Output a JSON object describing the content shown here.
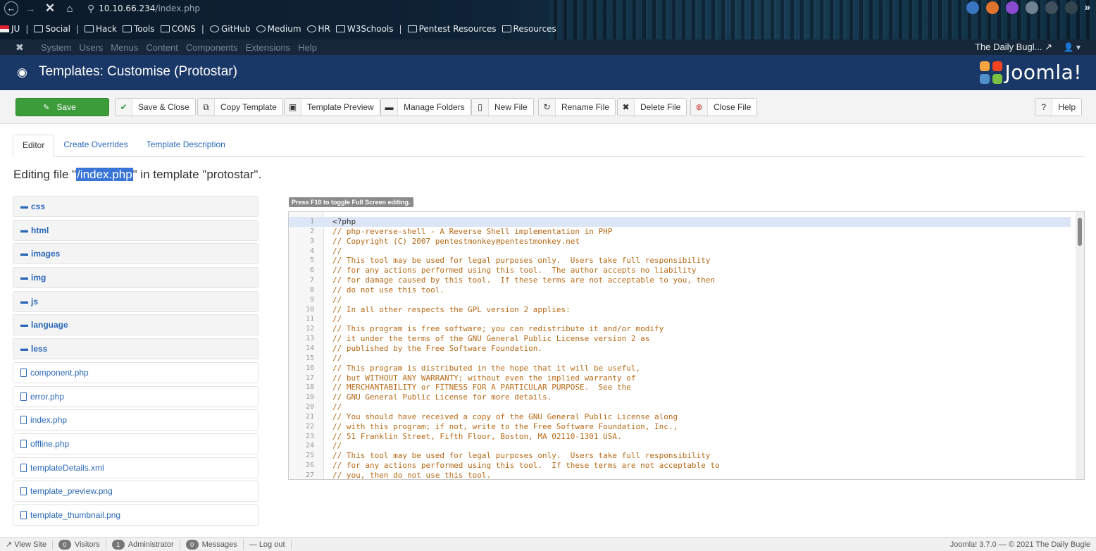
{
  "browser": {
    "url_host": "10.10.66.234",
    "url_path": "/index.php",
    "bookmarks": [
      {
        "label": "JU",
        "icon": "flag-icon"
      },
      {
        "label": "Social",
        "icon": "folder-icon"
      },
      {
        "label": "Hack",
        "icon": "folder-icon"
      },
      {
        "label": "Tools",
        "icon": "folder-icon"
      },
      {
        "label": "CONS",
        "icon": "folder-icon"
      },
      {
        "label": "GitHub",
        "icon": "github-icon"
      },
      {
        "label": "Medium",
        "icon": "medium-icon"
      },
      {
        "label": "HR",
        "icon": "globe-icon"
      },
      {
        "label": "W3Schools",
        "icon": "w3-icon"
      },
      {
        "label": "Pentest Resources",
        "icon": "folder-icon"
      },
      {
        "label": "Resources",
        "icon": "folder-icon"
      }
    ],
    "more_glyph": "»"
  },
  "admin_nav": {
    "menu": [
      "System",
      "Users",
      "Menus",
      "Content",
      "Components",
      "Extensions",
      "Help"
    ],
    "site_name": "The Daily Bugl..."
  },
  "page": {
    "title": "Templates: Customise (Protostar)",
    "brand": "Joomla!"
  },
  "toolbar": {
    "save": "Save",
    "save_close": "Save & Close",
    "copy_template": "Copy Template",
    "template_preview": "Template Preview",
    "manage_folders": "Manage Folders",
    "new_file": "New File",
    "rename_file": "Rename File",
    "delete_file": "Delete File",
    "close_file": "Close File",
    "help": "Help"
  },
  "tabs": [
    "Editor",
    "Create Overrides",
    "Template Description"
  ],
  "heading": {
    "prefix": "Editing file \"",
    "file": "/index.php",
    "suffix": "\" in template \"protostar\"."
  },
  "tree": {
    "folders": [
      "css",
      "html",
      "images",
      "img",
      "js",
      "language",
      "less"
    ],
    "files": [
      "component.php",
      "error.php",
      "index.php",
      "offline.php",
      "templateDetails.xml",
      "template_preview.png",
      "template_thumbnail.png"
    ]
  },
  "editor": {
    "hint": "Press F10 to toggle Full Screen editing.",
    "lines": [
      "<?php",
      "// php-reverse-shell - A Reverse Shell implementation in PHP",
      "// Copyright (C) 2007 pentestmonkey@pentestmonkey.net",
      "//",
      "// This tool may be used for legal purposes only.  Users take full responsibility",
      "// for any actions performed using this tool.  The author accepts no liability",
      "// for damage caused by this tool.  If these terms are not acceptable to you, then",
      "// do not use this tool.",
      "//",
      "// In all other respects the GPL version 2 applies:",
      "//",
      "// This program is free software; you can redistribute it and/or modify",
      "// it under the terms of the GNU General Public License version 2 as",
      "// published by the Free Software Foundation.",
      "//",
      "// This program is distributed in the hope that it will be useful,",
      "// but WITHOUT ANY WARRANTY; without even the implied warranty of",
      "// MERCHANTABILITY or FITNESS FOR A PARTICULAR PURPOSE.  See the",
      "// GNU General Public License for more details.",
      "//",
      "// You should have received a copy of the GNU General Public License along",
      "// with this program; if not, write to the Free Software Foundation, Inc.,",
      "// 51 Franklin Street, Fifth Floor, Boston, MA 02110-1301 USA.",
      "//",
      "// This tool may be used for legal purposes only.  Users take full responsibility",
      "// for any actions performed using this tool.  If these terms are not acceptable to",
      "// you, then do not use this tool."
    ]
  },
  "statusbar": {
    "view_site": "View Site",
    "visitors_count": "0",
    "visitors": "Visitors",
    "admin_count": "1",
    "admin": "Administrator",
    "messages_count": "0",
    "messages": "Messages",
    "logout": "Log out",
    "copyright": "Joomla! 3.7.0 — © 2021 The Daily Bugle"
  }
}
